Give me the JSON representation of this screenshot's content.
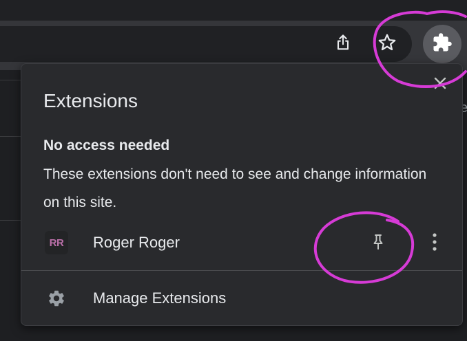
{
  "colors": {
    "popup_bg": "#292a2d",
    "toolbar_bg": "#35363a",
    "extension_button_bg": "#5a5b60",
    "text_primary": "#e8eaed",
    "icon_gray": "#9aa0a6",
    "extension_logo_color": "#b96fa8",
    "annotation_color": "#d63bd6"
  },
  "toolbar": {
    "share_icon": "share-icon",
    "bookmark_icon": "star-icon",
    "extensions_icon": "puzzle-piece-icon"
  },
  "page": {
    "side_text_fragment": "er"
  },
  "popup": {
    "title": "Extensions",
    "close_icon": "close-icon",
    "section": {
      "heading": "No access needed",
      "description": "These extensions don't need to see and change information on this site."
    },
    "extensions": [
      {
        "logo_text": "RR",
        "name": "Roger Roger",
        "pin_icon": "pin-icon",
        "more_icon": "more-vert-icon"
      }
    ],
    "manage": {
      "label": "Manage Extensions",
      "icon": "gear-icon"
    }
  }
}
